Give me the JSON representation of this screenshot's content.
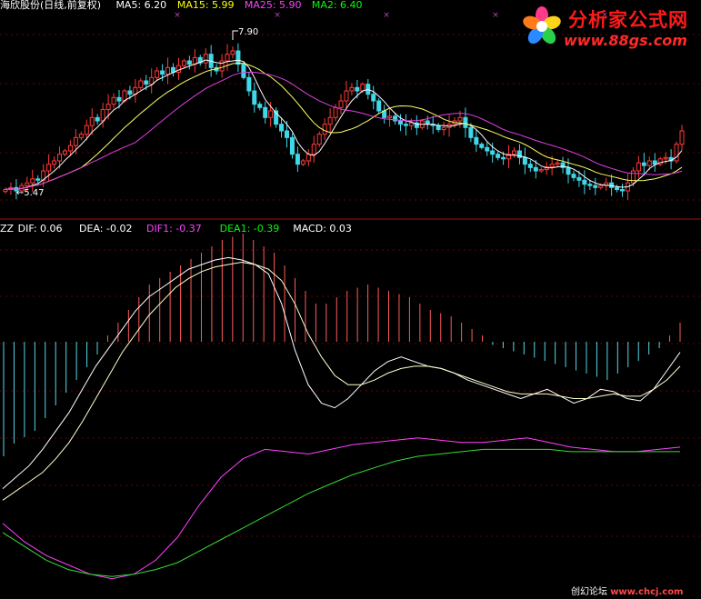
{
  "header": {
    "title": "海欣股份(日线,前复权)",
    "ma_items": [
      {
        "label": "MA5:",
        "value": "6.20",
        "color": "#ffffff"
      },
      {
        "label": "MA15:",
        "value": "5.99",
        "color": "#ffff00"
      },
      {
        "label": "MA25:",
        "value": "5.90",
        "color": "#ff40ff"
      },
      {
        "label": "MA2:",
        "value": "6.40",
        "color": "#00ff00"
      }
    ]
  },
  "indicator": {
    "name": "ZZ",
    "items": [
      {
        "label": "DIF:",
        "value": "0.06",
        "color": "#ffffff"
      },
      {
        "label": "DEA:",
        "value": "-0.02",
        "color": "#ffffff"
      },
      {
        "label": "DIF1:",
        "value": "-0.37",
        "color": "#ff40ff"
      },
      {
        "label": "DEA1:",
        "value": "-0.39",
        "color": "#00ff00"
      },
      {
        "label": "MACD:",
        "value": "0.03",
        "color": "#ffffff"
      }
    ]
  },
  "annotations": {
    "high": "7.90",
    "low": "5.47"
  },
  "watermark": {
    "name": "分析家公式网",
    "url": "www.88gs.com",
    "footer_left": "创幻论坛",
    "footer_right": "www.chcj.com"
  },
  "colors": {
    "up": "#ff3a3a",
    "down": "#3fd8e8",
    "ma5": "#ffffff",
    "ma15": "#ffff66",
    "ma25": "#e040e0",
    "dif1": "#ff40ff",
    "dea1": "#33dd33",
    "macd_pos": "#ff5a5a",
    "macd_neg": "#55d8e8"
  },
  "chart_data": [
    {
      "type": "candlestick",
      "panel": "price",
      "price_range": [
        5.2,
        8.2
      ],
      "close": [
        5.52,
        5.55,
        5.5,
        5.58,
        5.62,
        5.68,
        5.66,
        5.8,
        5.9,
        5.95,
        6.05,
        6.1,
        6.18,
        6.3,
        6.35,
        6.48,
        6.6,
        6.55,
        6.72,
        6.8,
        6.9,
        6.85,
        7.0,
        6.95,
        7.05,
        7.15,
        7.1,
        7.2,
        7.3,
        7.25,
        7.35,
        7.28,
        7.38,
        7.45,
        7.4,
        7.5,
        7.42,
        7.55,
        7.35,
        7.3,
        7.45,
        7.55,
        7.6,
        7.4,
        7.2,
        7.0,
        6.8,
        6.75,
        6.6,
        6.7,
        6.5,
        6.4,
        6.3,
        6.05,
        5.9,
        5.95,
        6.05,
        6.2,
        6.35,
        6.5,
        6.6,
        6.75,
        6.85,
        7.0,
        7.05,
        7.0,
        7.1,
        6.95,
        6.85,
        6.7,
        6.6,
        6.62,
        6.55,
        6.5,
        6.48,
        6.52,
        6.45,
        6.55,
        6.5,
        6.48,
        6.42,
        6.45,
        6.5,
        6.55,
        6.6,
        6.45,
        6.3,
        6.2,
        6.15,
        6.1,
        6.05,
        6.0,
        5.98,
        6.05,
        6.1,
        6.0,
        5.9,
        5.85,
        5.8,
        5.82,
        5.86,
        5.9,
        5.92,
        5.85,
        5.75,
        5.7,
        5.66,
        5.6,
        5.58,
        5.55,
        5.58,
        5.62,
        5.55,
        5.52,
        5.5,
        5.62,
        5.8,
        5.92,
        5.88,
        5.95,
        5.9,
        5.98,
        6.0,
        5.95,
        6.2,
        6.4
      ],
      "annotations": {
        "high": 7.9,
        "low": 5.47
      }
    },
    {
      "type": "line",
      "panel": "indicator",
      "series": [
        {
          "name": "DIF",
          "values": [
            -0.55,
            -0.5,
            -0.45,
            -0.38,
            -0.3,
            -0.22,
            -0.12,
            -0.02,
            0.06,
            0.14,
            0.22,
            0.28,
            0.32,
            0.36,
            0.4,
            0.42,
            0.44,
            0.45,
            0.44,
            0.42,
            0.38,
            0.25,
            0.05,
            -0.1,
            -0.18,
            -0.2,
            -0.16,
            -0.1,
            -0.04,
            0.0,
            0.02,
            0.0,
            -0.02,
            -0.03,
            -0.05,
            -0.08,
            -0.1,
            -0.12,
            -0.14,
            -0.16,
            -0.14,
            -0.12,
            -0.15,
            -0.18,
            -0.16,
            -0.12,
            -0.13,
            -0.16,
            -0.17,
            -0.12,
            -0.04,
            0.04
          ]
        },
        {
          "name": "DEA",
          "values": [
            -0.6,
            -0.56,
            -0.52,
            -0.48,
            -0.42,
            -0.35,
            -0.26,
            -0.16,
            -0.06,
            0.04,
            0.12,
            0.2,
            0.26,
            0.32,
            0.36,
            0.39,
            0.41,
            0.42,
            0.43,
            0.42,
            0.4,
            0.35,
            0.25,
            0.12,
            0.02,
            -0.06,
            -0.1,
            -0.1,
            -0.08,
            -0.05,
            -0.03,
            -0.02,
            -0.02,
            -0.03,
            -0.05,
            -0.07,
            -0.09,
            -0.11,
            -0.13,
            -0.14,
            -0.14,
            -0.14,
            -0.15,
            -0.16,
            -0.16,
            -0.15,
            -0.14,
            -0.15,
            -0.15,
            -0.12,
            -0.08,
            -0.02
          ]
        },
        {
          "name": "DIF1",
          "values": [
            -0.7,
            -0.78,
            -0.84,
            -0.88,
            -0.92,
            -0.94,
            -0.92,
            -0.86,
            -0.76,
            -0.62,
            -0.5,
            -0.42,
            -0.38,
            -0.39,
            -0.4,
            -0.38,
            -0.36,
            -0.35,
            -0.34,
            -0.33,
            -0.34,
            -0.35,
            -0.35,
            -0.34,
            -0.33,
            -0.35,
            -0.37,
            -0.38,
            -0.39,
            -0.39,
            -0.38,
            -0.37
          ]
        },
        {
          "name": "DEA1",
          "values": [
            -0.74,
            -0.8,
            -0.86,
            -0.9,
            -0.92,
            -0.93,
            -0.92,
            -0.9,
            -0.87,
            -0.82,
            -0.77,
            -0.72,
            -0.67,
            -0.62,
            -0.57,
            -0.53,
            -0.49,
            -0.46,
            -0.43,
            -0.41,
            -0.4,
            -0.39,
            -0.38,
            -0.38,
            -0.38,
            -0.38,
            -0.39,
            -0.39,
            -0.39,
            -0.39,
            -0.39,
            -0.39
          ]
        }
      ],
      "macd_bars": [
        -0.18,
        -0.16,
        -0.15,
        -0.14,
        -0.12,
        -0.1,
        -0.08,
        -0.06,
        -0.04,
        -0.02,
        0.01,
        0.03,
        0.05,
        0.07,
        0.09,
        0.1,
        0.11,
        0.12,
        0.13,
        0.14,
        0.15,
        0.16,
        0.165,
        0.17,
        0.16,
        0.15,
        0.14,
        0.12,
        0.1,
        0.08,
        0.06,
        0.06,
        0.07,
        0.08,
        0.085,
        0.09,
        0.085,
        0.08,
        0.075,
        0.07,
        0.06,
        0.05,
        0.045,
        0.04,
        0.03,
        0.02,
        0.01,
        -0.005,
        -0.01,
        -0.015,
        -0.02,
        -0.025,
        -0.03,
        -0.035,
        -0.04,
        -0.045,
        -0.05,
        -0.055,
        -0.06,
        -0.05,
        -0.04,
        -0.03,
        -0.02,
        -0.01,
        0.01,
        0.03
      ]
    }
  ]
}
